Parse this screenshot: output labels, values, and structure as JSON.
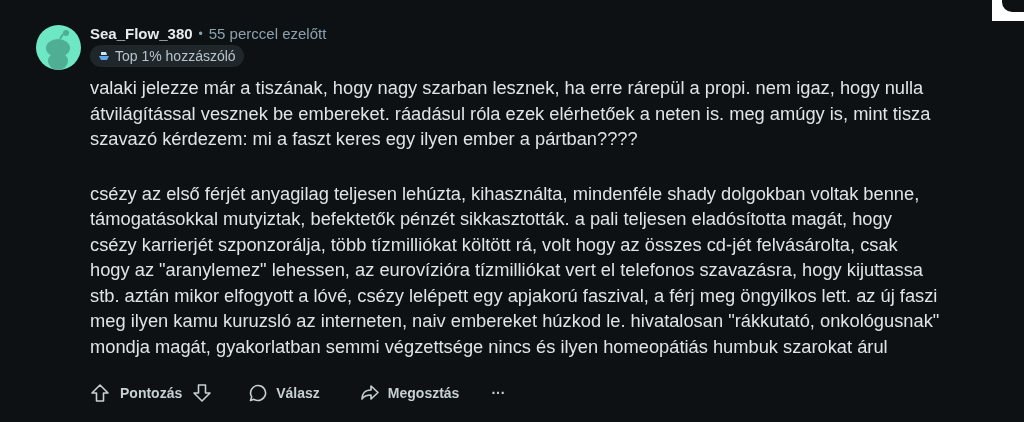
{
  "comment": {
    "author": "Sea_Flow_380",
    "separator": "•",
    "time": "55 perccel ezelőtt",
    "badge": "Top 1% hozzászóló",
    "paragraphs": [
      {
        "lines": [
          "valaki jelezze már a tiszának, hogy nagy szarban lesznek, ha erre rárepül a propi. nem igaz, hogy nulla",
          "átvilágítással vesznek be embereket. ráadásul róla ezek elérhetőek a neten is. meg amúgy is, mint tisza",
          "szavazó kérdezem: mi a faszt keres egy ilyen ember a pártban????"
        ]
      },
      {
        "lines": [
          "csézy az első férjét anyagilag teljesen lehúzta, kihasználta, mindenféle shady dolgokban voltak benne,",
          "támogatásokkal mutyiztak, befektetők pénzét sikkasztották. a pali teljesen eladósította magát, hogy",
          "csézy karrierjét szponzorálja, több tízmilliókat költött rá, volt hogy az összes cd-jét felvásárolta, csak",
          "hogy az \"aranylemez\" lehessen, az eurovízióra tízmilliókat vert el telefonos szavazásra, hogy kijuttassa",
          "stb. aztán mikor elfogyott a lóvé, csézy lelépett egy apjakorú faszival, a férj meg öngyilkos lett. az új faszi",
          "meg ilyen kamu kuruzsló az interneten, naiv embereket húzkod le. hivatalosan \"rákkutató, onkológusnak\"",
          "mondja magát, gyakorlatban semmi végzettsége nincs és ilyen homeopátiás humbuk szarokat árul"
        ]
      }
    ],
    "actions": [
      {
        "kind": "vote",
        "label": "Pontozás"
      },
      {
        "kind": "reply",
        "label": "Válasz"
      },
      {
        "kind": "share",
        "label": "Megosztás"
      },
      {
        "kind": "more",
        "label": "···"
      }
    ]
  }
}
